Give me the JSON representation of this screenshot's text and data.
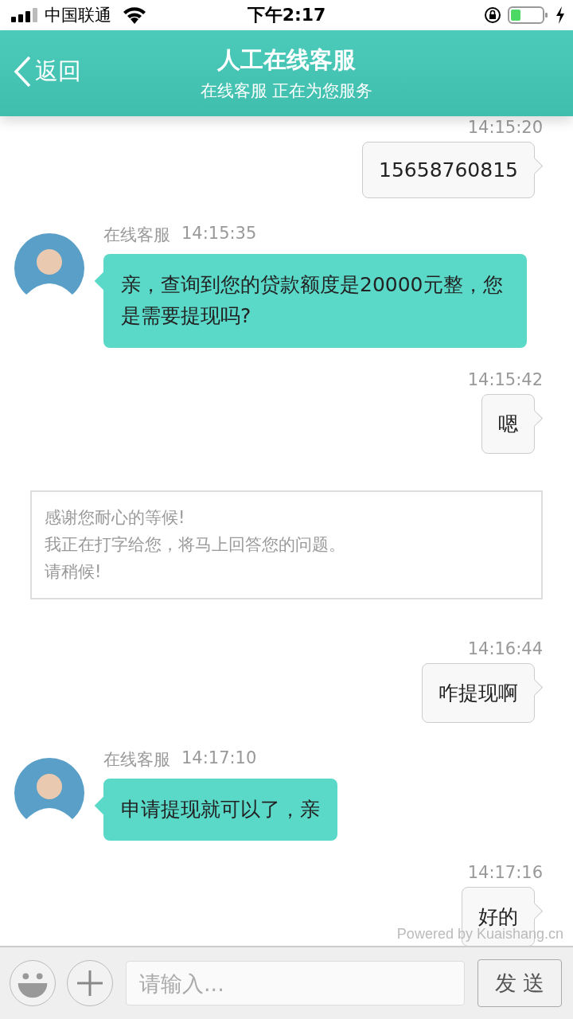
{
  "status_bar": {
    "carrier": "中国联通",
    "time": "下午2:17"
  },
  "header": {
    "back": "返回",
    "title": "人工在线客服",
    "subtitle": "在线客服 正在为您服务"
  },
  "messages": [
    {
      "kind": "out",
      "time": "14:15:20",
      "text": "15658760815"
    },
    {
      "kind": "in",
      "sender": "在线客服",
      "time": "14:15:35",
      "text": "亲，查询到您的贷款额度是20000元整，您是需要提现吗?"
    },
    {
      "kind": "out",
      "time": "14:15:42",
      "text": "嗯"
    },
    {
      "kind": "notice",
      "lines": [
        "感谢您耐心的等候!",
        "我正在打字给您，将马上回答您的问题。",
        "请稍候!"
      ]
    },
    {
      "kind": "out",
      "time": "14:16:44",
      "text": "咋提现啊"
    },
    {
      "kind": "in",
      "sender": "在线客服",
      "time": "14:17:10",
      "text": "申请提现就可以了，亲"
    },
    {
      "kind": "out",
      "time": "14:17:16",
      "text": "好的"
    }
  ],
  "powered_by": "Powered by Kuaishang.cn",
  "composer": {
    "placeholder": "请输入...",
    "send": "发 送"
  }
}
